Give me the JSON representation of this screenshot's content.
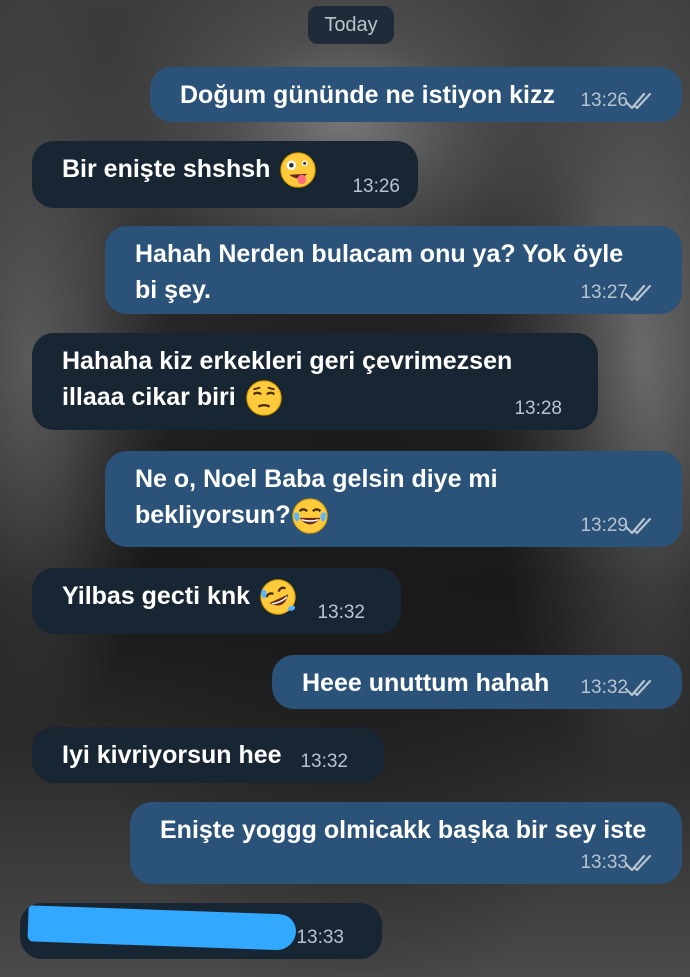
{
  "chat": {
    "date_label": "Today",
    "messages": [
      {
        "side": "out",
        "text": "Doğum gününde ne istiyon kizz",
        "time": "13:26",
        "ticks": "double-check-icon"
      },
      {
        "side": "in",
        "text": "Bir enişte shshsh",
        "emoji": "zany-face-emoji",
        "time": "13:26"
      },
      {
        "side": "out",
        "text": "Hahah Nerden bulacam onu ya? Yok öyle bi şey.",
        "time": "13:27",
        "ticks": "double-check-icon"
      },
      {
        "side": "in",
        "text": "Hahaha kiz erkekleri geri çevrimezsen illaaa cikar biri",
        "emoji": "unamused-face-emoji",
        "time": "13:28"
      },
      {
        "side": "out",
        "text": "Ne o, Noel Baba gelsin diye mi bekliyorsun?",
        "emoji": "tears-of-joy-emoji",
        "time": "13:29",
        "ticks": "double-check-icon"
      },
      {
        "side": "in",
        "text": "Yilbas gecti knk",
        "emoji": "rofl-emoji",
        "time": "13:32"
      },
      {
        "side": "out",
        "text": "Heee unuttum hahah",
        "time": "13:32",
        "ticks": "double-check-icon"
      },
      {
        "side": "in",
        "text": "Iyi kivriyorsun hee",
        "time": "13:32"
      },
      {
        "side": "out",
        "text": "Enişte yoggg olmicakk başka bir sey iste",
        "time": "13:33",
        "ticks": "double-check-icon"
      },
      {
        "side": "in",
        "text": "",
        "redacted": true,
        "time": "13:33"
      }
    ]
  },
  "colors": {
    "outgoing_bubble": "#2b5278",
    "incoming_bubble": "#182533",
    "date_chip": "#1f2b38",
    "redaction": "#32a8ff"
  }
}
